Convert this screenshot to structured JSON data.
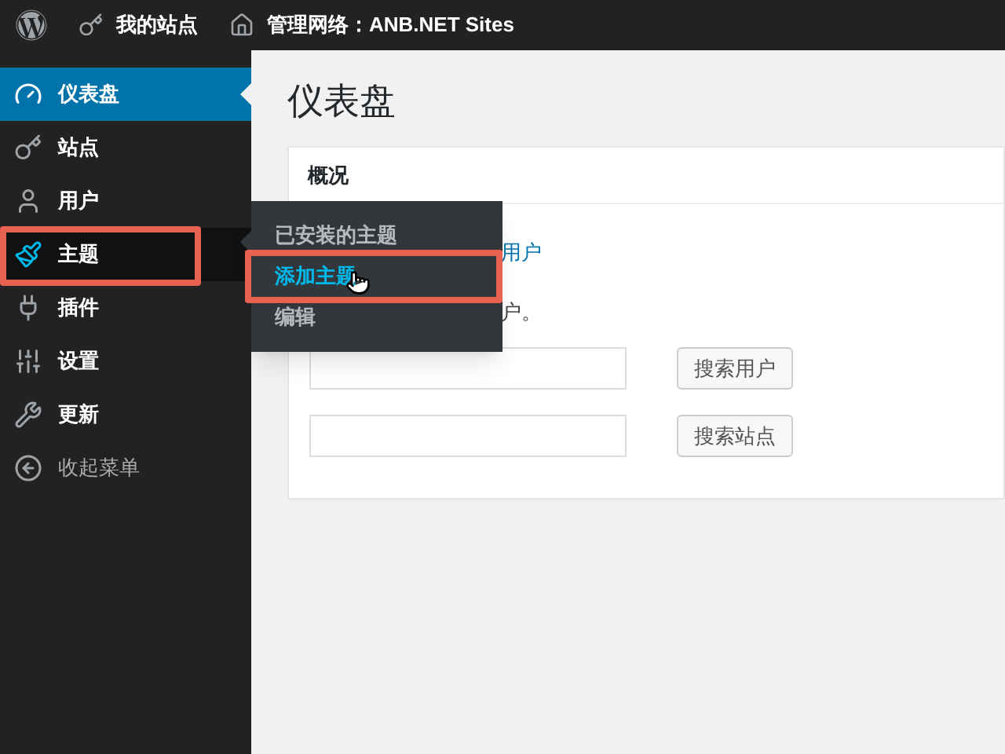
{
  "top_bar": {
    "items": [
      {
        "kind": "logo"
      },
      {
        "kind": "key",
        "label": "我的站点"
      },
      {
        "kind": "home",
        "label": "管理网络：ANB.NET Sites"
      }
    ]
  },
  "sidebar": {
    "items": [
      {
        "kind": "dashboard",
        "label": "仪表盘",
        "selected": true,
        "highlighted": false
      },
      {
        "kind": "key",
        "label": "站点",
        "selected": false,
        "highlighted": false
      },
      {
        "kind": "user",
        "label": "用户",
        "selected": false,
        "highlighted": false
      },
      {
        "kind": "brush",
        "label": "主题",
        "selected": false,
        "highlighted": true,
        "expanded": true,
        "children": [
          {
            "label": "已安装的主题",
            "selected": false,
            "highlighted": false
          },
          {
            "label": "添加主题",
            "selected": true,
            "highlighted": true
          },
          {
            "label": "编辑",
            "selected": false,
            "highlighted": false
          }
        ]
      },
      {
        "kind": "plug",
        "label": "插件",
        "selected": false,
        "highlighted": false
      },
      {
        "kind": "settings",
        "label": "设置",
        "selected": false,
        "highlighted": false
      },
      {
        "kind": "wrench",
        "label": "更新",
        "selected": false,
        "highlighted": false
      },
      {
        "kind": "collapse",
        "label": "收起菜单",
        "selected": false,
        "highlighted": false
      }
    ]
  },
  "page": {
    "title": "仪表盘",
    "card": {
      "title": "概况",
      "link": "用户",
      "text": "户。",
      "searches": [
        {
          "button": "搜索用户"
        },
        {
          "button": "搜索站点"
        }
      ]
    }
  }
}
